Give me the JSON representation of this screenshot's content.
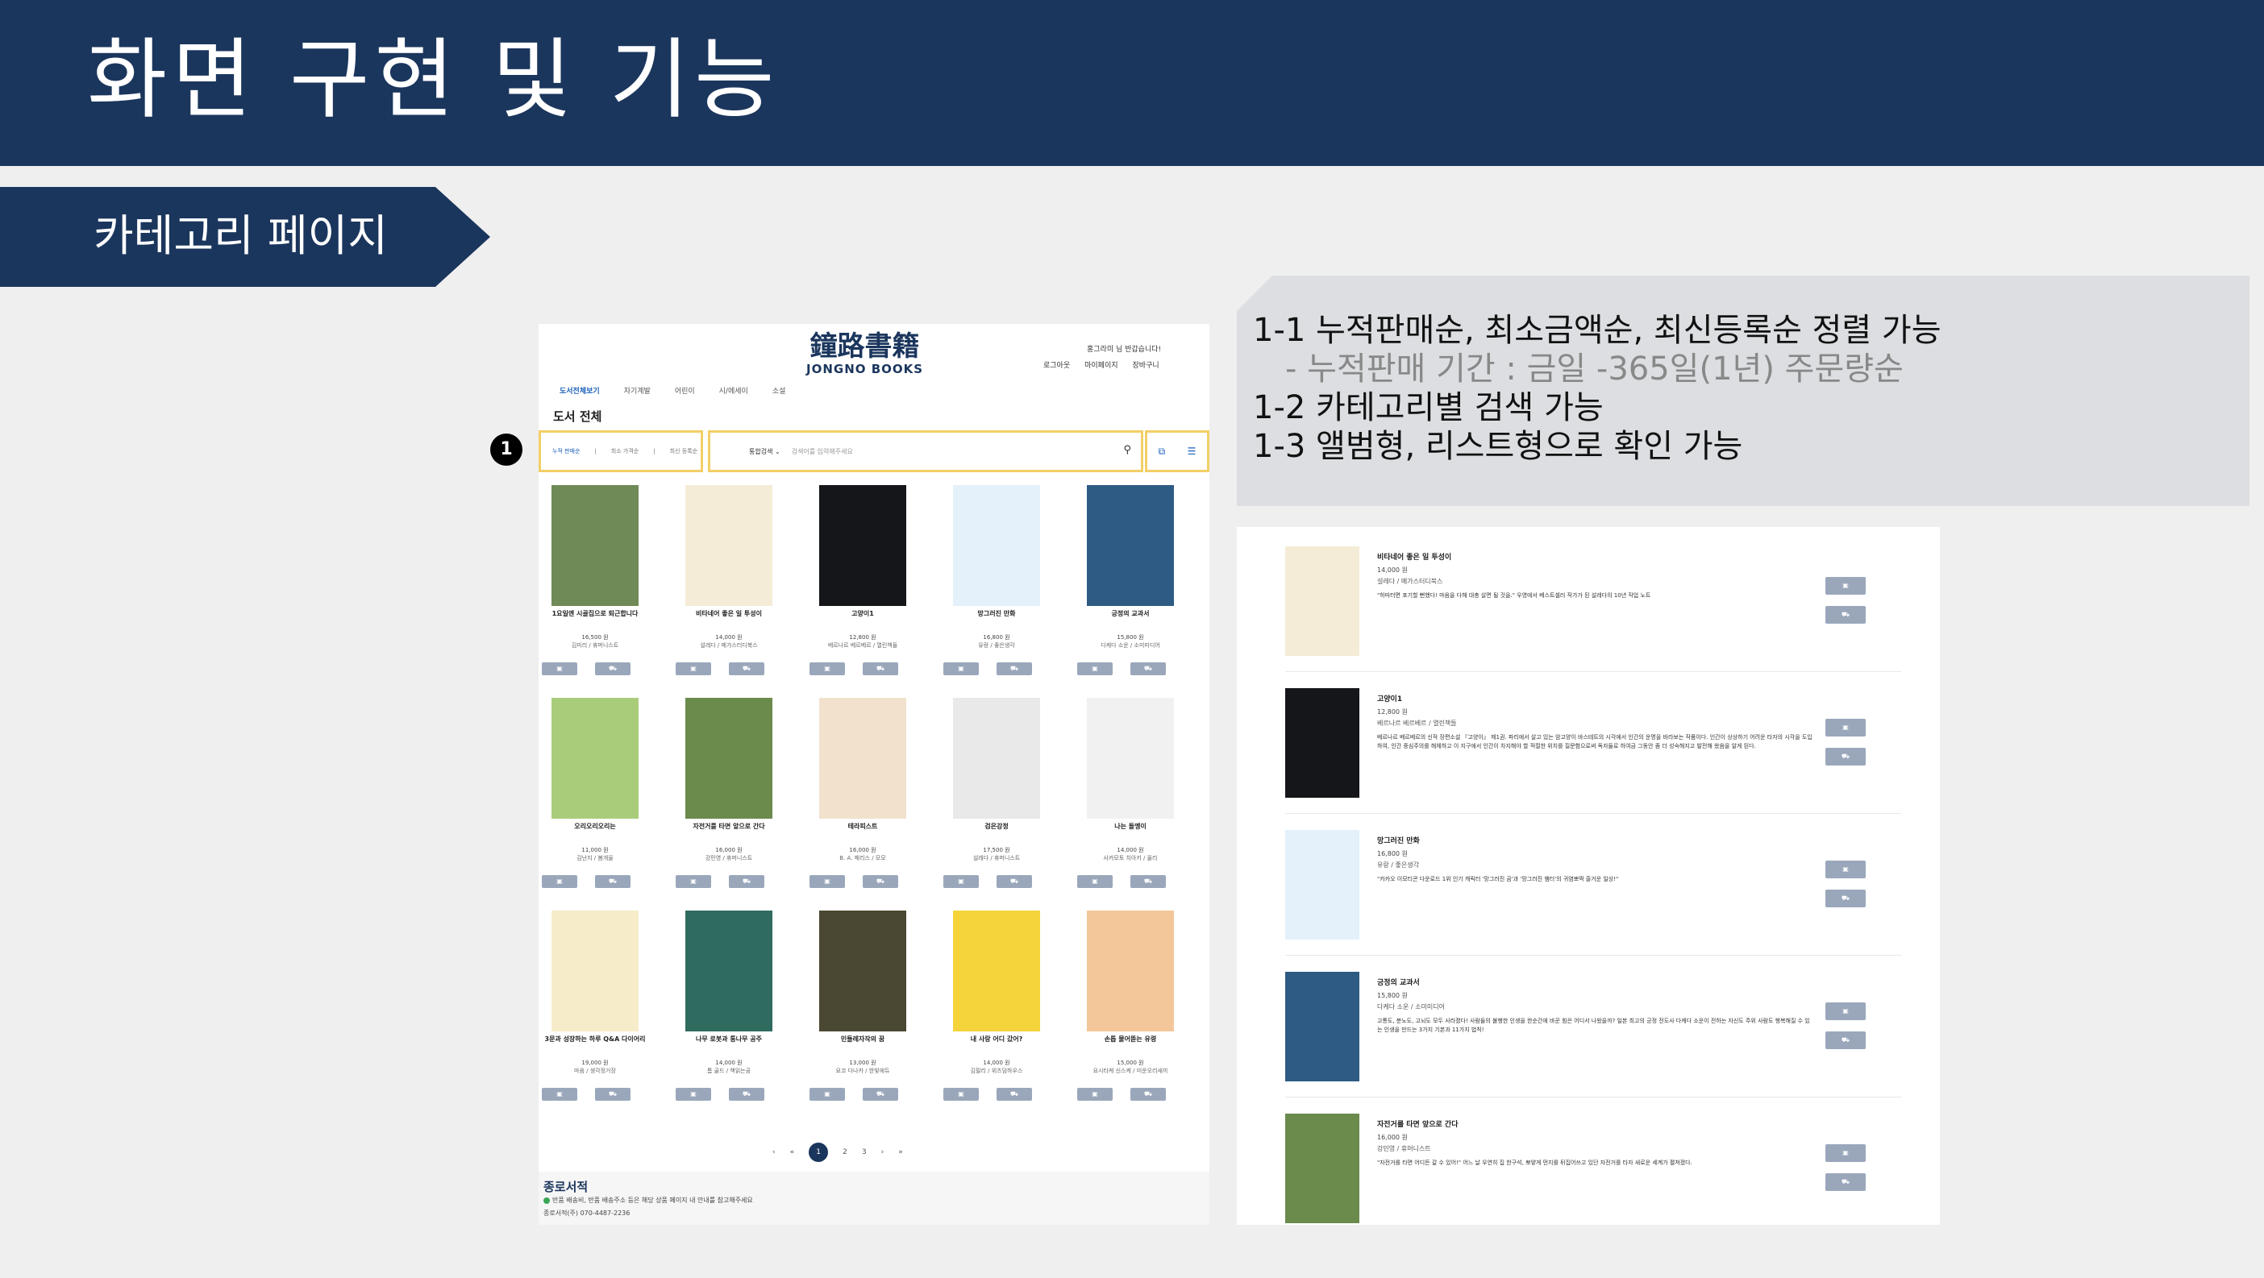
{
  "slide": {
    "title": "화면 구현 및 기능",
    "section": "카테고리 페이지",
    "badge": "1"
  },
  "colors": {
    "navy": "#1b365d",
    "highlight": "#f2cf67",
    "button": "#9aa7bb",
    "accent_link": "#1b5fb8"
  },
  "site": {
    "logo_hanja": "鐘路書籍",
    "logo_english": "JONGNO BOOKS",
    "greeting": "홍그라미 님 반갑습니다!",
    "header_links": [
      "로그아웃",
      "마이페이지",
      "장바구니"
    ],
    "nav_tabs": [
      "도서전체보기",
      "자기계발",
      "어린이",
      "시/에세이",
      "소설"
    ],
    "page_heading": "도서 전체",
    "sort_options": [
      "누적 판매순",
      "최소 가격순",
      "최신 등록순"
    ],
    "search_select": "통합검색",
    "search_placeholder": "검색어를 입력해주세요",
    "view_icons": [
      "album-icon",
      "list-icon"
    ]
  },
  "grid_books": [
    {
      "title": "1요일엔 시골집으로 퇴근합니다",
      "price": "16,500 원",
      "author": "김미리 / 휴머니스트",
      "cover": "#6f8a57"
    },
    {
      "title": "비타네어 좋은 일 투성이",
      "price": "14,000 원",
      "author": "설레다 / 메가스터디북스",
      "cover": "#f4ecd6"
    },
    {
      "title": "고양이1",
      "price": "12,800 원",
      "author": "베르나르 베르베르 / 열린책들",
      "cover": "#15161a"
    },
    {
      "title": "망그러진 만화",
      "price": "16,800 원",
      "author": "유랑 / 좋은생각",
      "cover": "#e4f1fb"
    },
    {
      "title": "긍정의 교과서",
      "price": "15,800 원",
      "author": "다케다 소운 / 소미미디어",
      "cover": "#2d5b84"
    },
    {
      "title": "오리오리오리는",
      "price": "11,000 원",
      "author": "김난지 / 봄개울",
      "cover": "#a9cc7a"
    },
    {
      "title": "자전거를 타면 앞으로 간다",
      "price": "16,000 원",
      "author": "강민영 / 휴머니스트",
      "cover": "#6b8b4c"
    },
    {
      "title": "테라피스트",
      "price": "16,000 원",
      "author": "B. A. 패리스 / 모모",
      "cover": "#f2e2cd"
    },
    {
      "title": "검은강정",
      "price": "17,500 원",
      "author": "설레다 / 휴머니스트",
      "cover": "#e9e9e9"
    },
    {
      "title": "나는 돌멩이",
      "price": "14,000 원",
      "author": "사카모토 치아키 / 올리",
      "cover": "#f1f1f1"
    },
    {
      "title": "3문과 성장하는 하루 Q&A 다이어리",
      "price": "19,000 원",
      "author": "마음 / 생각정거장",
      "cover": "#f7ecc9"
    },
    {
      "title": "나무 로봇과 통나무 공주",
      "price": "14,000 원",
      "author": "톰 골드 / 책읽는곰",
      "cover": "#2f6b5f"
    },
    {
      "title": "민들레자작의 꿈",
      "price": "13,000 원",
      "author": "요코 다나카 / 한빛에듀",
      "cover": "#4a4732"
    },
    {
      "title": "내 사랑 어디 갔어?",
      "price": "14,000 원",
      "author": "김필리 / 위즈덤하우스",
      "cover": "#f4d43a"
    },
    {
      "title": "손톱 물어뜯는 유령",
      "price": "15,000 원",
      "author": "요시타케 신스케 / 미운오리새끼",
      "cover": "#f3c79a"
    }
  ],
  "button_icons": [
    "bag-icon",
    "cart-icon"
  ],
  "pagination": [
    "‹",
    "«",
    "1",
    "2",
    "3",
    "›",
    "»"
  ],
  "footer": {
    "brand": "종로서적",
    "line1": "반품 배송비, 반품 배송주소 등은 해당 상품 페이지 내 안내를 참고해주세요",
    "line2": "종로서적(주) 070-4487-2236"
  },
  "features": [
    "1-1 누적판매순, 최소금액순, 최신등록순 정렬 가능",
    "- 누적판매 기간 : 금일 -365일(1년) 주문량순",
    "1-2  카테고리별 검색 가능",
    "1-3 앨범형, 리스트형으로 확인 가능"
  ],
  "list_books": [
    {
      "title": "비타네어 좋은 일 투성이",
      "price": "14,000 원",
      "author": "설레다 / 메가스터디북스",
      "cover": "#f4ecd6",
      "desc": "\"하마터면 포기할 뻔했다! 마음을 다해 대충 살면 될 것을.\" 우영에서 베스트셀러 작가가 된 설레다의 10년 작업 노트"
    },
    {
      "title": "고양이1",
      "price": "12,800 원",
      "author": "베르나르 베르베르 / 열린책들",
      "cover": "#15161a",
      "desc": "베르나르 베르베르의 신작 장편소설 『고양이』 제1권. 파리에서 살고 있는 암고양이 바스테트의 시각에서 인간의 운명을 바라보는 작품이다. 인간이 상상하기 어려운 타자의 시각을 도입하여, 인간 중심주의를 해체하고 이 지구에서 인간이 차지해야 할 적절한 위치를 질문함으로써 독자들로 하여금 그동안 좀 더 성숙해지고 발전해 왔음을 알게 된다."
    },
    {
      "title": "망그러진 만화",
      "price": "16,800 원",
      "author": "유랑 / 좋은생각",
      "cover": "#e4f1fb",
      "desc": "\"카카오 이모티콘 다운로드 1위 인기 캐릭터 '망그러진 곰'과 '망그러진 햄터'의 귀염뽀짝 즐거운 일상!\""
    },
    {
      "title": "긍정의 교과서",
      "price": "15,800 원",
      "author": "다케다 소운 / 소미미디어",
      "cover": "#2d5b84",
      "desc": "고통도, 분노도, 고뇌도 모두 사라졌다! 사람들의 불행한 인생을 한순간에 바꾼 힘은 어디서 나왔을까? 일본 최고의 긍정 전도사 다케다 소운이 전하는 자신도 주위 사람도 행복해질 수 있는 인생을 만드는 3가지 기본과 11가지 법칙!"
    },
    {
      "title": "자전거를 타면 앞으로 간다",
      "price": "16,000 원",
      "author": "강민영 / 휴머니스트",
      "cover": "#6b8b4c",
      "desc": "\"자전거를 타면 어디든 갈 수 있어!\" 어느 날 우연히 집 한구석, 뽀얗게 먼지를 뒤집어쓰고 있던 자전거를 타자 새로운 세계가 펼쳐졌다."
    }
  ]
}
